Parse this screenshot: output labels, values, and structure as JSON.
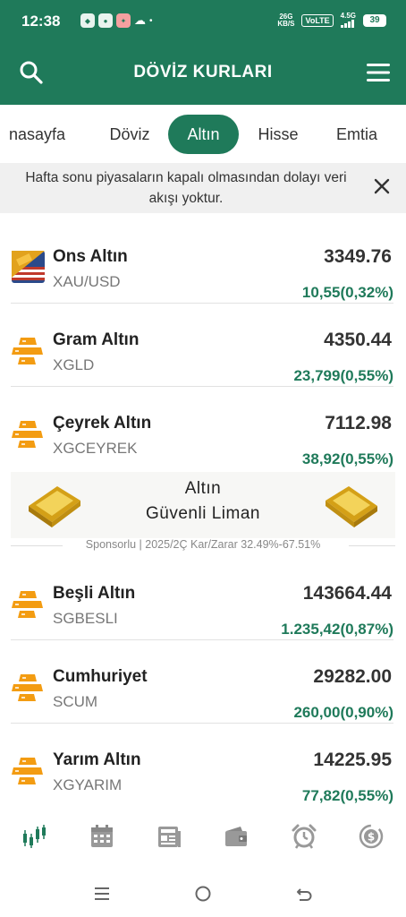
{
  "status": {
    "time": "12:38",
    "net_speed_top": "26G",
    "net_speed_bottom": "KB/S",
    "volte": "VoLTE",
    "network": "4.5G",
    "battery": "39"
  },
  "header": {
    "title": "DÖVİZ KURLARI"
  },
  "tabs": [
    {
      "label": "nasayfa"
    },
    {
      "label": "Döviz"
    },
    {
      "label": "Altın"
    },
    {
      "label": "Hisse"
    },
    {
      "label": "Emtia"
    }
  ],
  "notice": {
    "text": "Hafta sonu piyasaların kapalı olmasından dolayı veri akışı yoktur."
  },
  "rows": [
    {
      "name": "Ons Altın",
      "code": "XAU/USD",
      "price": "3349.76",
      "change": "10,55(0,32%)"
    },
    {
      "name": "Gram Altın",
      "code": "XGLD",
      "price": "4350.44",
      "change": "23,799(0,55%)"
    },
    {
      "name": "Çeyrek Altın",
      "code": "XGCEYREK",
      "price": "7112.98",
      "change": "38,92(0,55%)"
    },
    {
      "name": "Beşli Altın",
      "code": "SGBESLI",
      "price": "143664.44",
      "change": "1.235,42(0,87%)"
    },
    {
      "name": "Cumhuriyet",
      "code": "SCUM",
      "price": "29282.00",
      "change": "260,00(0,90%)"
    },
    {
      "name": "Yarım Altın",
      "code": "XGYARIM",
      "price": "14225.95",
      "change": "77,82(0,55%)"
    }
  ],
  "ad": {
    "line1": "Altın",
    "line2": "Güvenli Liman",
    "sponsor": "Sponsorlu | 2025/2Ç Kar/Zarar 32.49%-67.51%"
  },
  "colors": {
    "brand_green": "#1f7a5a",
    "gold": "#f39c12",
    "notice_bg": "#f0f0f0"
  },
  "icons": {
    "bottom_nav": [
      "chart-icon",
      "calendar-icon",
      "news-icon",
      "wallet-icon",
      "alarm-icon",
      "currency-exchange-icon"
    ]
  }
}
